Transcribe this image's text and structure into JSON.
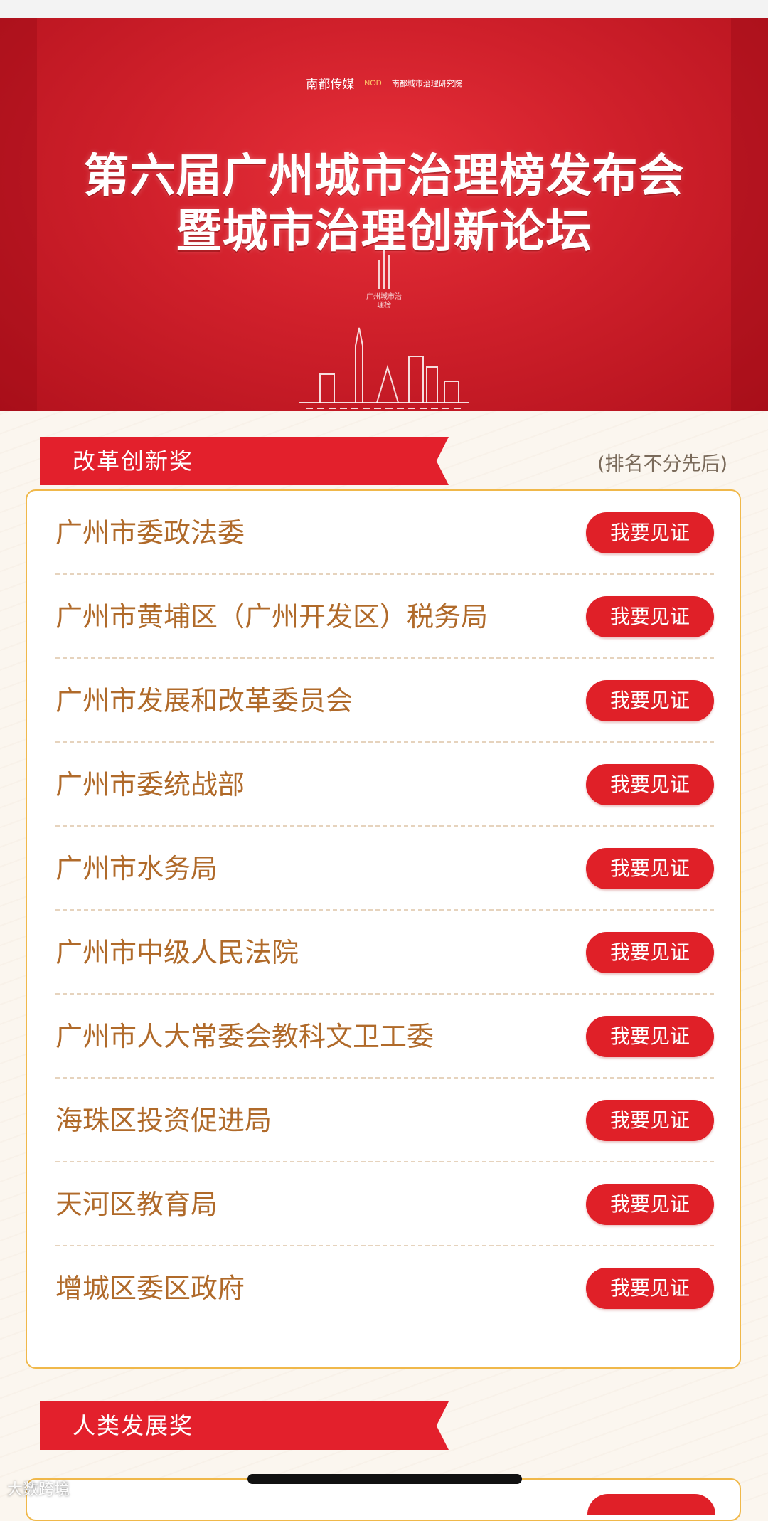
{
  "banner": {
    "logo_1": "南都传媒",
    "logo_1_sub": "NOD",
    "logo_2": "南都城市治理研究院",
    "title_line_1": "第六届广州城市治理榜发布会",
    "title_line_2": "暨城市治理创新论坛",
    "emblem_text": "广州城市治理榜"
  },
  "section_1": {
    "title": "改革创新奖",
    "note": "(排名不分先后)",
    "items": [
      {
        "name": "广州市委政法委",
        "button": "我要见证"
      },
      {
        "name": "广州市黄埔区（广州开发区）税务局",
        "button": "我要见证"
      },
      {
        "name": "广州市发展和改革委员会",
        "button": "我要见证"
      },
      {
        "name": "广州市委统战部",
        "button": "我要见证"
      },
      {
        "name": "广州市水务局",
        "button": "我要见证"
      },
      {
        "name": "广州市中级人民法院",
        "button": "我要见证"
      },
      {
        "name": "广州市人大常委会教科文卫工委",
        "button": "我要见证"
      },
      {
        "name": "海珠区投资促进局",
        "button": "我要见证"
      },
      {
        "name": "天河区教育局",
        "button": "我要见证"
      },
      {
        "name": "增城区委区政府",
        "button": "我要见证"
      }
    ]
  },
  "section_2": {
    "title": "人类发展奖"
  },
  "watermark": "大数跨境",
  "colors": {
    "banner_red": "#d0202b",
    "button_red": "#e02028",
    "card_border": "#f0b84a",
    "item_text": "#b06a2a"
  }
}
